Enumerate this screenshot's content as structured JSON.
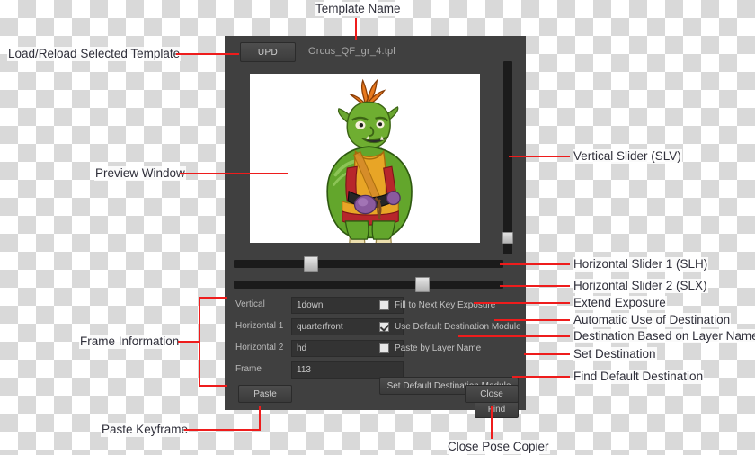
{
  "dialog": {
    "upd_button_label": "UPD",
    "template_name": "Orcus_QF_gr_4.tpl",
    "preview": {
      "character": "green-orc-character"
    },
    "sliders": {
      "vertical": {
        "name": "SLV",
        "value_pct": 92
      },
      "horizontal_1": {
        "name": "SLH",
        "value_pct": 27
      },
      "horizontal_2": {
        "name": "SLX",
        "value_pct": 69
      }
    },
    "fields": [
      {
        "label": "Vertical",
        "value": "1down"
      },
      {
        "label": "Horizontal 1",
        "value": "quarterfront"
      },
      {
        "label": "Horizontal 2",
        "value": "hd"
      },
      {
        "label": "Frame",
        "value": "113"
      }
    ],
    "checkboxes": [
      {
        "label": "Fill to Next Key Exposure",
        "checked": false
      },
      {
        "label": "Use Default Destination Module",
        "checked": true
      },
      {
        "label": "Paste by Layer Name",
        "checked": false
      }
    ],
    "buttons": {
      "set_default_destination": "Set Default Destination Module",
      "find": "Find",
      "paste": "Paste",
      "close": "Close"
    }
  },
  "annotations": {
    "template_name": "Template Name",
    "load_reload": "Load/Reload Selected Template",
    "preview_window": "Preview Window",
    "frame_information": "Frame Information",
    "paste_keyframe": "Paste Keyframe",
    "close_pose_copier": "Close Pose Copier",
    "vertical_slider": "Vertical Slider (SLV)",
    "horizontal_slider_1": "Horizontal Slider 1 (SLH)",
    "horizontal_slider_2": "Horizontal Slider 2 (SLX)",
    "extend_exposure": "Extend Exposure",
    "automatic_use_of_destination": "Automatic Use of Destination",
    "destination_based_on_layer_name": "Destination Based on Layer Name",
    "set_destination": "Set Destination",
    "find_default_destination": "Find Default Destination"
  },
  "colors": {
    "dialog_bg": "#404040",
    "annotation_red": "#ee1c1c",
    "field_bg": "#333333",
    "track": "#1b1b1b"
  }
}
